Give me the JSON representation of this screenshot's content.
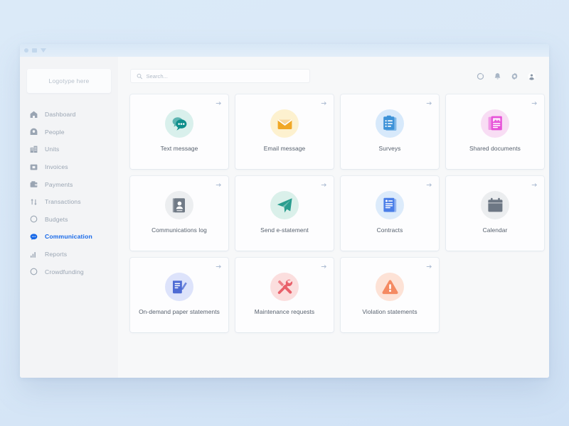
{
  "window": {
    "titlebar_icons": [
      "circle-dot",
      "square",
      "triangle"
    ]
  },
  "sidebar": {
    "logo_text": "Logotype here",
    "items": [
      {
        "label": "Dashboard",
        "icon": "home-icon",
        "active": false
      },
      {
        "label": "People",
        "icon": "person-icon",
        "active": false
      },
      {
        "label": "Units",
        "icon": "building-icon",
        "active": false
      },
      {
        "label": "Invoices",
        "icon": "invoice-icon",
        "active": false
      },
      {
        "label": "Payments",
        "icon": "wallet-icon",
        "active": false
      },
      {
        "label": "Transactions",
        "icon": "transfer-icon",
        "active": false
      },
      {
        "label": "Budgets",
        "icon": "circle-icon",
        "active": false
      },
      {
        "label": "Communication",
        "icon": "chat-icon",
        "active": true
      },
      {
        "label": "Reports",
        "icon": "bar-chart-icon",
        "active": false
      },
      {
        "label": "Crowdfunding",
        "icon": "coin-icon",
        "active": false
      }
    ],
    "active_color": "#1869e8",
    "inactive_color": "#9aa5b3"
  },
  "topbar": {
    "search": {
      "placeholder": "Search...",
      "value": "",
      "icon": "search-icon"
    },
    "icons": [
      {
        "name": "sync-icon"
      },
      {
        "name": "bell-icon"
      },
      {
        "name": "gear-icon"
      },
      {
        "name": "avatar-icon"
      }
    ]
  },
  "cards": [
    {
      "label": "Text message",
      "icon": "chat-bubble-icon",
      "bg": "#d9f0ec",
      "fg": "#0f8f8c",
      "arrow": "arrow-right-icon"
    },
    {
      "label": "Email message",
      "icon": "envelope-icon",
      "bg": "#fdf1cf",
      "fg": "#f0a726",
      "arrow": "arrow-right-icon"
    },
    {
      "label": "Surveys",
      "icon": "clipboard-list-icon",
      "bg": "#d7e9fb",
      "fg": "#3d92d8",
      "arrow": "arrow-right-icon"
    },
    {
      "label": "Shared documents",
      "icon": "documents-icon",
      "bg": "#f8ddf4",
      "fg": "#e752d8",
      "arrow": "arrow-right-icon"
    },
    {
      "label": "Communications log",
      "icon": "contact-book-icon",
      "bg": "#eceef0",
      "fg": "#707a86",
      "arrow": "arrow-right-icon"
    },
    {
      "label": "Send e-statement",
      "icon": "paper-plane-icon",
      "bg": "#daf0ea",
      "fg": "#2a9d8f",
      "arrow": "arrow-right-icon"
    },
    {
      "label": "Contracts",
      "icon": "contract-doc-icon",
      "bg": "#dcebfb",
      "fg": "#4a7ee8",
      "arrow": "arrow-right-icon"
    },
    {
      "label": "Calendar",
      "icon": "calendar-icon",
      "bg": "#ebedef",
      "fg": "#6d7784",
      "arrow": "arrow-right-icon"
    },
    {
      "label": "On-demand paper statements",
      "icon": "note-pencil-icon",
      "bg": "#dde3fb",
      "fg": "#4e6bd4",
      "arrow": "arrow-right-icon"
    },
    {
      "label": "Maintenance requests",
      "icon": "tools-icon",
      "bg": "#fbdede",
      "fg": "#e8606a",
      "arrow": "arrow-right-icon"
    },
    {
      "label": "Violation statements",
      "icon": "warning-triangle-icon",
      "bg": "#fde2d6",
      "fg": "#f48a62",
      "arrow": "arrow-right-icon"
    }
  ]
}
